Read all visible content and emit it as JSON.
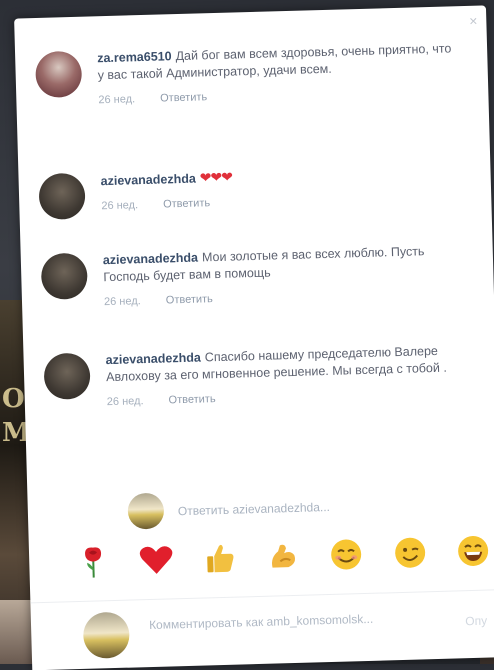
{
  "comments": [
    {
      "username": "za.rema6510",
      "text": "Дай бог вам всем здоровья, очень приятно, что у вас такой Администратор, удачи всем.",
      "time": "26 нед.",
      "reply_label": "Ответить"
    },
    {
      "username": "azievanadezhda",
      "text": "❤❤❤",
      "time": "26 нед.",
      "reply_label": "Ответить"
    },
    {
      "username": "azievanadezhda",
      "text": "Мои золотые я вас всех люблю. Пусть Господь будет вам в помощь",
      "time": "26 нед.",
      "reply_label": "Ответить"
    },
    {
      "username": "azievanadezhda",
      "text": "Спасибо нашему председателю Валере Авлохову за его мгновенное решение. Мы всегда с тобой .",
      "time": "26 нед.",
      "reply_label": "Ответить"
    }
  ],
  "reply_box": {
    "placeholder": "Ответить azievanadezhda..."
  },
  "emoji_bar": [
    {
      "icon": "rose-icon"
    },
    {
      "icon": "red-heart-icon"
    },
    {
      "icon": "thumbs-up-icon"
    },
    {
      "icon": "flexed-biceps-icon"
    },
    {
      "icon": "smiling-face-icon"
    },
    {
      "icon": "winking-face-icon"
    },
    {
      "icon": "grinning-face-icon"
    }
  ],
  "composer": {
    "placeholder": "Комментировать как amb_komsomolsk...",
    "action_label": "Опу"
  },
  "colors": {
    "username": "#3a4e6a",
    "text": "#5d6270",
    "meta": "#a6b0bd",
    "heart": "#e0303a"
  }
}
